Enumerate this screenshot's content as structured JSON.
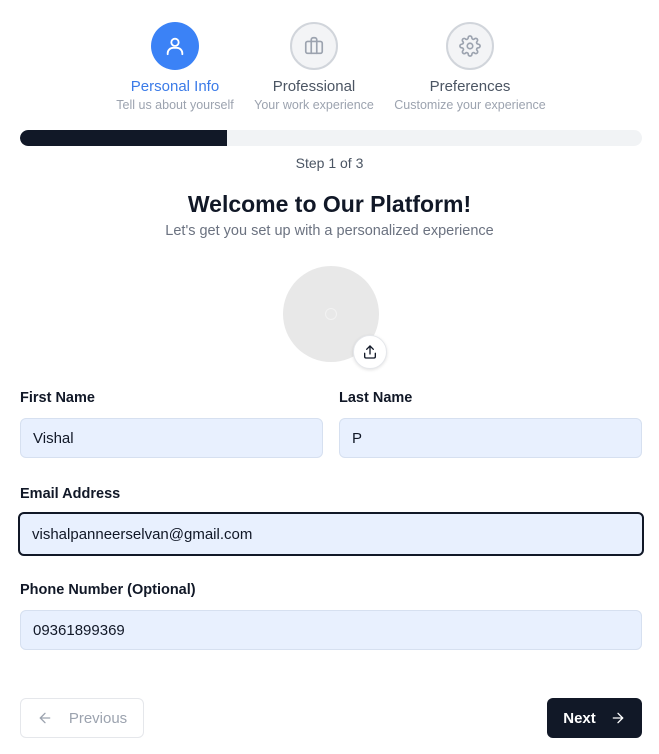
{
  "steps": [
    {
      "title": "Personal Info",
      "subtitle": "Tell us about yourself",
      "icon": "user-icon",
      "state": "active"
    },
    {
      "title": "Professional",
      "subtitle": "Your work experience",
      "icon": "briefcase-icon",
      "state": "inactive"
    },
    {
      "title": "Preferences",
      "subtitle": "Customize your experience",
      "icon": "gear-icon",
      "state": "inactive"
    }
  ],
  "progress": {
    "fraction": 0.333,
    "label": "Step 1 of 3"
  },
  "header": {
    "title": "Welcome to Our Platform!",
    "subtitle": "Let's get you set up with a personalized experience"
  },
  "avatar": {
    "upload_icon": "upload-icon"
  },
  "form": {
    "first_name": {
      "label": "First Name",
      "value": "Vishal"
    },
    "last_name": {
      "label": "Last Name",
      "value": "P"
    },
    "email": {
      "label": "Email Address",
      "value": "vishalpanneerselvan@gmail.com"
    },
    "phone": {
      "label": "Phone Number (Optional)",
      "value": "09361899369"
    }
  },
  "actions": {
    "previous_label": "Previous",
    "next_label": "Next"
  },
  "colors": {
    "accent": "#3b82f6",
    "dark": "#111827",
    "input_bg": "#e8f0fe",
    "muted": "#9ca3af"
  }
}
